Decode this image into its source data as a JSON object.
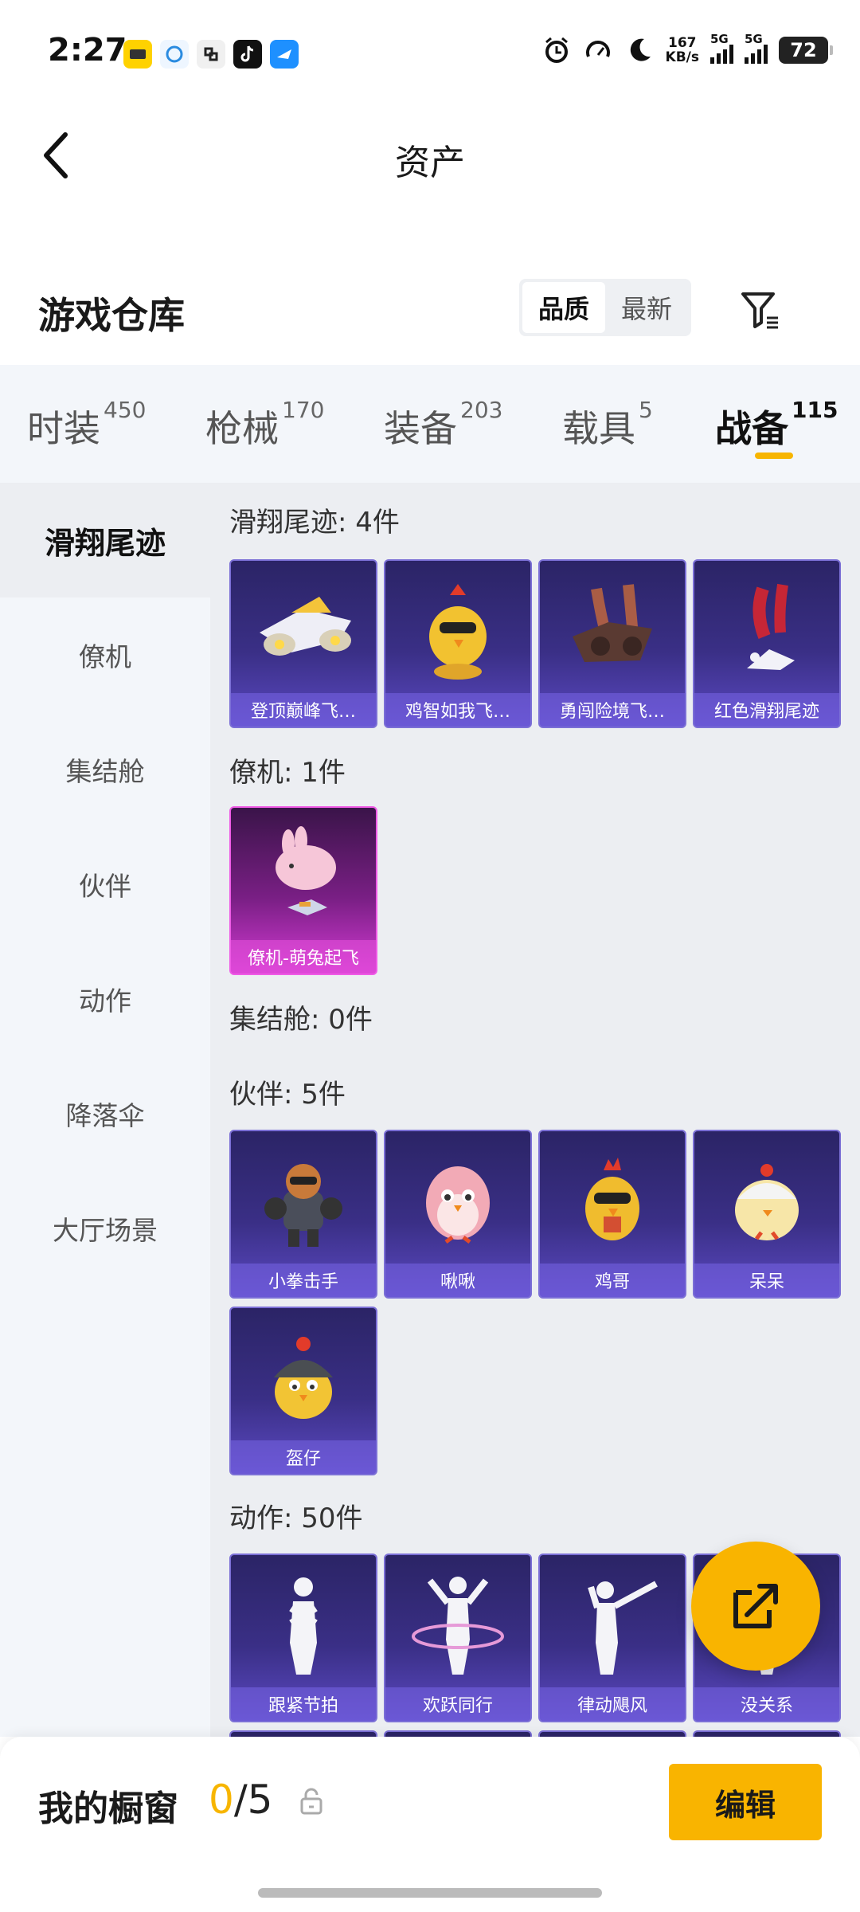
{
  "status_bar": {
    "time": "2:27",
    "net_speed_value": "167",
    "net_speed_unit": "KB/s",
    "signal1_label": "5G",
    "signal2_label": "5G",
    "battery": "72",
    "apps": [
      "yellow-app-icon",
      "sim-icon",
      "connect-icon",
      "tiktok-icon",
      "mail-icon"
    ],
    "system_icons": [
      "alarm-icon",
      "speed-icon",
      "moon-icon"
    ]
  },
  "header": {
    "title": "资产"
  },
  "warehouse": {
    "title": "游戏仓库",
    "sort_options": [
      "品质",
      "最新"
    ],
    "sort_selected": "品质"
  },
  "tabs": [
    {
      "label": "时装",
      "count": "450"
    },
    {
      "label": "枪械",
      "count": "170"
    },
    {
      "label": "装备",
      "count": "203"
    },
    {
      "label": "载具",
      "count": "5"
    },
    {
      "label": "战备",
      "count": "115"
    }
  ],
  "active_tab": "战备",
  "sidebar": {
    "items": [
      "滑翔尾迹",
      "僚机",
      "集结舱",
      "伙伴",
      "动作",
      "降落伞",
      "大厅场景"
    ],
    "active": "滑翔尾迹"
  },
  "sections": [
    {
      "title": "滑翔尾迹: 4件",
      "items": [
        "登顶巅峰飞…",
        "鸡智如我飞…",
        "勇闯险境飞…",
        "红色滑翔尾迹"
      ]
    },
    {
      "title": "僚机: 1件",
      "items": [
        "僚机-萌兔起飞"
      ]
    },
    {
      "title": "集结舱: 0件",
      "items": []
    },
    {
      "title": "伙伴: 5件",
      "items": [
        "小拳击手",
        "啾啾",
        "鸡哥",
        "呆呆",
        "盔仔"
      ]
    },
    {
      "title": "动作: 50件",
      "items": [
        "跟紧节拍",
        "欢跃同行",
        "律动飓风",
        "没关系"
      ]
    }
  ],
  "bottom_bar": {
    "showcase_label": "我的橱窗",
    "showcase_current": "0",
    "showcase_total": "/5",
    "edit_label": "编辑"
  },
  "colors": {
    "accent": "#F9B400",
    "card_purple": "#3A2F86",
    "card_pink": "#D33AD3"
  }
}
